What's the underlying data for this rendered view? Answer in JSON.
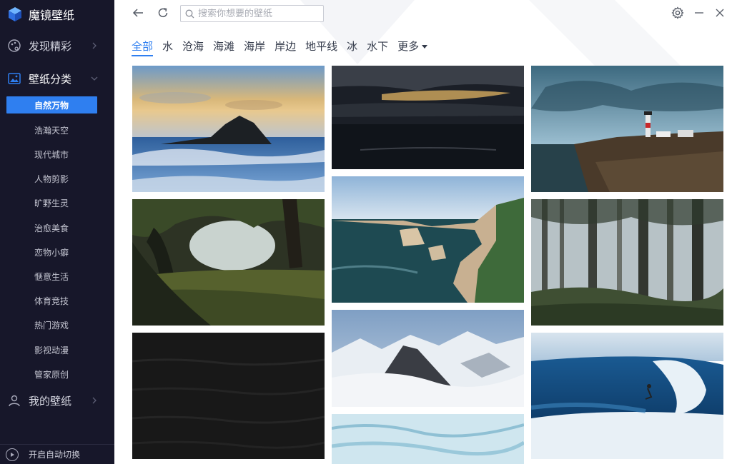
{
  "app": {
    "title": "魔镜壁纸"
  },
  "sidebar": {
    "groups": [
      {
        "label": "发现精彩"
      },
      {
        "label": "壁纸分类"
      },
      {
        "label": "我的壁纸"
      }
    ],
    "categories": [
      "自然万物",
      "浩瀚天空",
      "现代城市",
      "人物剪影",
      "旷野生灵",
      "治愈美食",
      "恋物小癖",
      "惬意生活",
      "体育竞技",
      "热门游戏",
      "影视动漫",
      "管家原创"
    ],
    "selected_category": "自然万物",
    "auto_switch_label": "开启自动切换"
  },
  "toolbar": {
    "search_placeholder": "搜索你想要的壁纸"
  },
  "tabs": [
    "全部",
    "水",
    "沧海",
    "海滩",
    "海岸",
    "岸边",
    "地平线",
    "冰",
    "水下",
    "更多"
  ],
  "active_tab": "全部",
  "accent_color": "#2f7ff0",
  "sidebar_bg": "#17172a"
}
